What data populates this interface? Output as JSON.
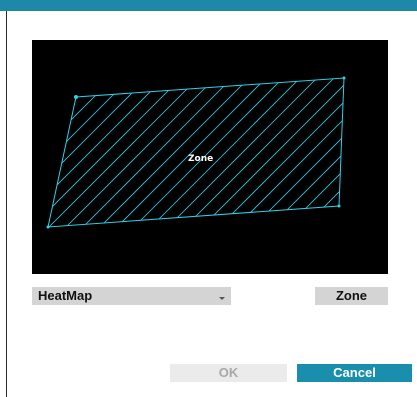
{
  "preview": {
    "zone_label": "Zone"
  },
  "controls": {
    "view_mode_select": "HeatMap",
    "zone_button": "Zone"
  },
  "footer": {
    "ok_label": "OK",
    "ok_enabled": false,
    "cancel_label": "Cancel"
  },
  "colors": {
    "accent": "#1a8fad",
    "zone_outline": "#2fd0e8",
    "preview_background": "#000000"
  }
}
